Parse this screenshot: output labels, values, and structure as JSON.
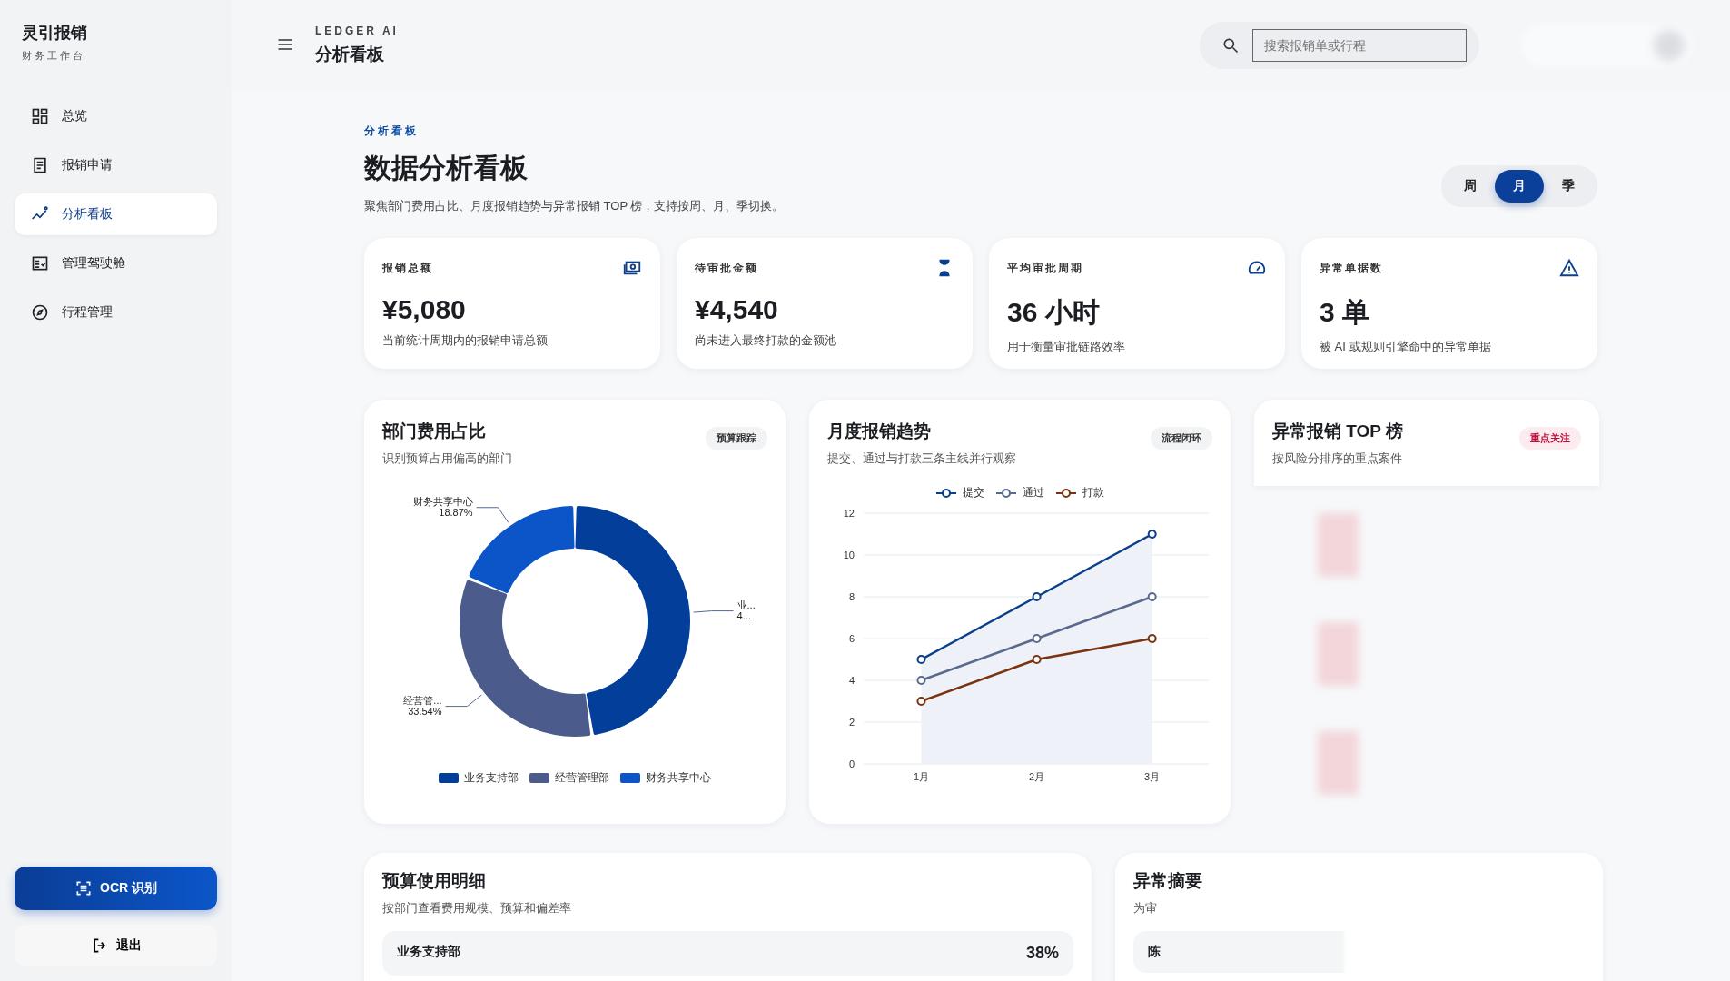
{
  "app": {
    "brand": "灵引报销",
    "subtitle": "财务工作台"
  },
  "sidebar": {
    "items": [
      {
        "label": "总览",
        "selected": false
      },
      {
        "label": "报销申请",
        "selected": false
      },
      {
        "label": "分析看板",
        "selected": true
      },
      {
        "label": "管理驾驶舱",
        "selected": false
      },
      {
        "label": "行程管理",
        "selected": false
      }
    ],
    "ocr_button": "OCR 识别",
    "logout_button": "退出"
  },
  "header": {
    "eyebrow": "LEDGER AI",
    "title": "分析看板",
    "search": {
      "placeholder": "搜索报销单或行程"
    }
  },
  "page": {
    "eyebrow": "分析看板",
    "title": "数据分析看板",
    "description": "聚焦部门费用占比、月度报销趋势与异常报销 TOP 榜，支持按周、月、季切换。",
    "periods": [
      {
        "label": "周",
        "selected": false
      },
      {
        "label": "月",
        "selected": true
      },
      {
        "label": "季",
        "selected": false
      }
    ]
  },
  "kpis": [
    {
      "label": "报销总额",
      "value": "¥5,080",
      "note": "当前统计周期内的报销申请总额"
    },
    {
      "label": "待审批金额",
      "value": "¥4,540",
      "note": "尚未进入最终打款的金额池"
    },
    {
      "label": "平均审批周期",
      "value": "36 小时",
      "note": "用于衡量审批链路效率"
    },
    {
      "label": "异常单据数",
      "value": "3 单",
      "note": "被 AI 或规则引擎命中的异常单据"
    }
  ],
  "department_card": {
    "title": "部门费用占比",
    "subtitle": "识别预算占用偏高的部门",
    "tag": "预算跟踪",
    "slice_labels": [
      {
        "name": "财务共享中心",
        "value": "18.87%"
      },
      {
        "name": "业...",
        "value": "4..."
      },
      {
        "name": "经营管...",
        "value": "33.54%"
      }
    ],
    "chart_data": {
      "type": "donut",
      "categories": [
        "业务支持部",
        "经营管理部",
        "财务共享中心"
      ],
      "values": [
        47.59,
        33.54,
        18.87
      ],
      "colors": [
        "#023e9a",
        "#4a5b8c",
        "#0b55c9"
      ]
    }
  },
  "trend_card": {
    "title": "月度报销趋势",
    "subtitle": "提交、通过与打款三条主线并行观察",
    "tag": "流程闭环",
    "chart_data": {
      "type": "line",
      "x": [
        "1月",
        "2月",
        "3月"
      ],
      "ylim": [
        0,
        12
      ],
      "yticks": [
        0,
        2,
        4,
        6,
        8,
        10,
        12
      ],
      "grid": true,
      "series": [
        {
          "name": "提交",
          "color": "#0a3f8c",
          "values": [
            5,
            8,
            11
          ],
          "marker": "o",
          "type": "area"
        },
        {
          "name": "通过",
          "color": "#5a6a8e",
          "values": [
            4,
            6,
            8
          ],
          "marker": "o",
          "type": "line"
        },
        {
          "name": "打款",
          "color": "#7a3310",
          "values": [
            3,
            5,
            6
          ],
          "marker": "o",
          "type": "line"
        }
      ]
    }
  },
  "top_card": {
    "title": "异常报销 TOP 榜",
    "subtitle": "按风险分排序的重点案件",
    "tag": "重点关注"
  },
  "budget_card": {
    "title": "预算使用明细",
    "subtitle": "按部门查看费用规模、预算和偏差率",
    "rows": [
      {
        "name": "业务支持部",
        "percent": "38%"
      }
    ]
  },
  "anomaly_card": {
    "title": "异常摘要",
    "subtitle": "为审",
    "rows": [
      {
        "name": "陈"
      }
    ]
  }
}
